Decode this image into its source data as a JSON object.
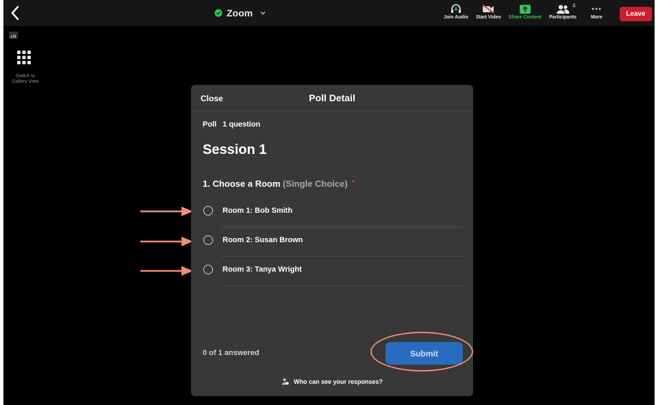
{
  "window": {
    "title": "Zoom"
  },
  "toolbar": {
    "join_audio": "Join Audio",
    "start_video": "Start Video",
    "share_content": "Share Content",
    "participants": "Participants",
    "participants_count": "4",
    "more": "More",
    "leave": "Leave"
  },
  "sidebar": {
    "gallery_label": "Switch to\nGallery View"
  },
  "modal": {
    "close_label": "Close",
    "title": "Poll Detail",
    "poll_label": "Poll",
    "question_count": "1 question",
    "session_title": "Session 1",
    "question": {
      "text": "1. Choose a Room",
      "type": "(Single Choice)",
      "required_mark": "*"
    },
    "options": [
      "Room 1: Bob Smith",
      "Room 2: Susan Brown",
      "Room 3: Tanya Wright"
    ],
    "answered_status": "0 of 1 answered",
    "submit_label": "Submit",
    "visibility_link": "Who can see your responses?"
  },
  "colors": {
    "leave": "#cd1f2b",
    "share_green": "#31c25a",
    "submit_blue": "#2a6bc2",
    "annotation": "#f08d72",
    "required": "#ff3b3b"
  },
  "icons": [
    "back-chevron-icon",
    "shield-icon",
    "chevron-down-icon",
    "headphones-icon",
    "video-off-icon",
    "share-screen-icon",
    "participants-icon",
    "more-dots-icon",
    "stats-icon",
    "gallery-grid-icon",
    "person-lock-icon",
    "arrow-right-icon"
  ]
}
